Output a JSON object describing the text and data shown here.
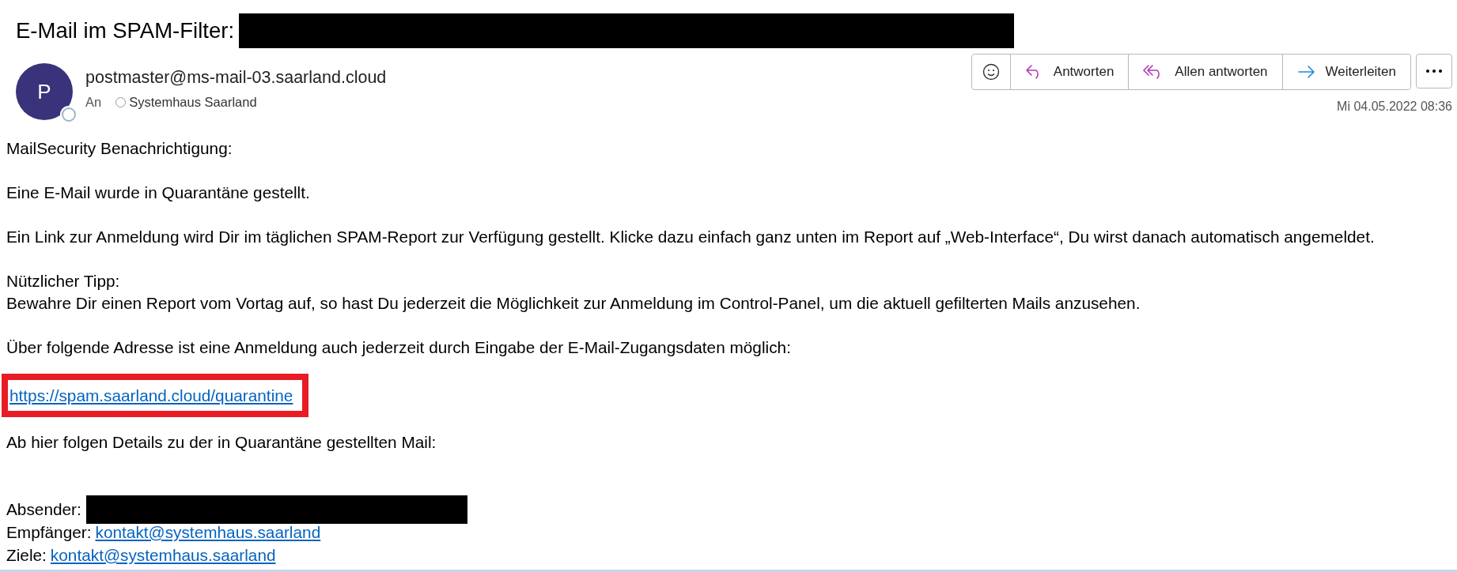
{
  "subject": {
    "label": "E-Mail im SPAM-Filter:",
    "redacted": true
  },
  "sender": {
    "initial": "P",
    "address": "postmaster@ms-mail-03.saarland.cloud"
  },
  "recipient": {
    "label": "An",
    "name": "Systemhaus Saarland"
  },
  "actions": [
    {
      "kind": "emoji"
    },
    {
      "kind": "reply",
      "label": "Antworten"
    },
    {
      "kind": "reply_all",
      "label": "Allen antworten"
    },
    {
      "kind": "forward",
      "label": "Weiterleiten"
    }
  ],
  "date": "Mi 04.05.2022 08:36",
  "body": [
    {
      "kind": "text",
      "lines": [
        "MailSecurity Benachrichtigung:"
      ]
    },
    {
      "kind": "text",
      "lines": [
        "Eine E-Mail wurde in Quarantäne gestellt."
      ]
    },
    {
      "kind": "text",
      "lines": [
        "Ein Link zur Anmeldung wird Dir im täglichen SPAM-Report zur Verfügung gestellt. Klicke dazu einfach ganz unten im Report auf „Web-Interface“, Du wirst danach automatisch angemeldet."
      ]
    },
    {
      "kind": "text",
      "lines": [
        "Nützlicher Tipp:",
        "Bewahre Dir einen Report vom Vortag auf, so hast Du jederzeit die Möglichkeit zur Anmeldung im Control-Panel, um die aktuell gefilterten Mails anzusehen."
      ]
    },
    {
      "kind": "text",
      "lines": [
        "Über folgende Adresse ist eine Anmeldung auch jederzeit durch Eingabe der E-Mail-Zugangsdaten möglich:"
      ]
    },
    {
      "kind": "link",
      "text": "https://spam.saarland.cloud/quarantine",
      "highlighted": true
    },
    {
      "kind": "text",
      "lines": [
        "Ab hier folgen Details zu der in Quarantäne gestellten Mail:"
      ]
    },
    {
      "kind": "fields",
      "rows": [
        {
          "label": "Absender:",
          "redacted": true
        },
        {
          "label": "Empfänger:",
          "link": "kontakt@systemhaus.saarland"
        },
        {
          "label": "Ziele:",
          "link": "kontakt@systemhaus.saarland"
        }
      ]
    }
  ]
}
